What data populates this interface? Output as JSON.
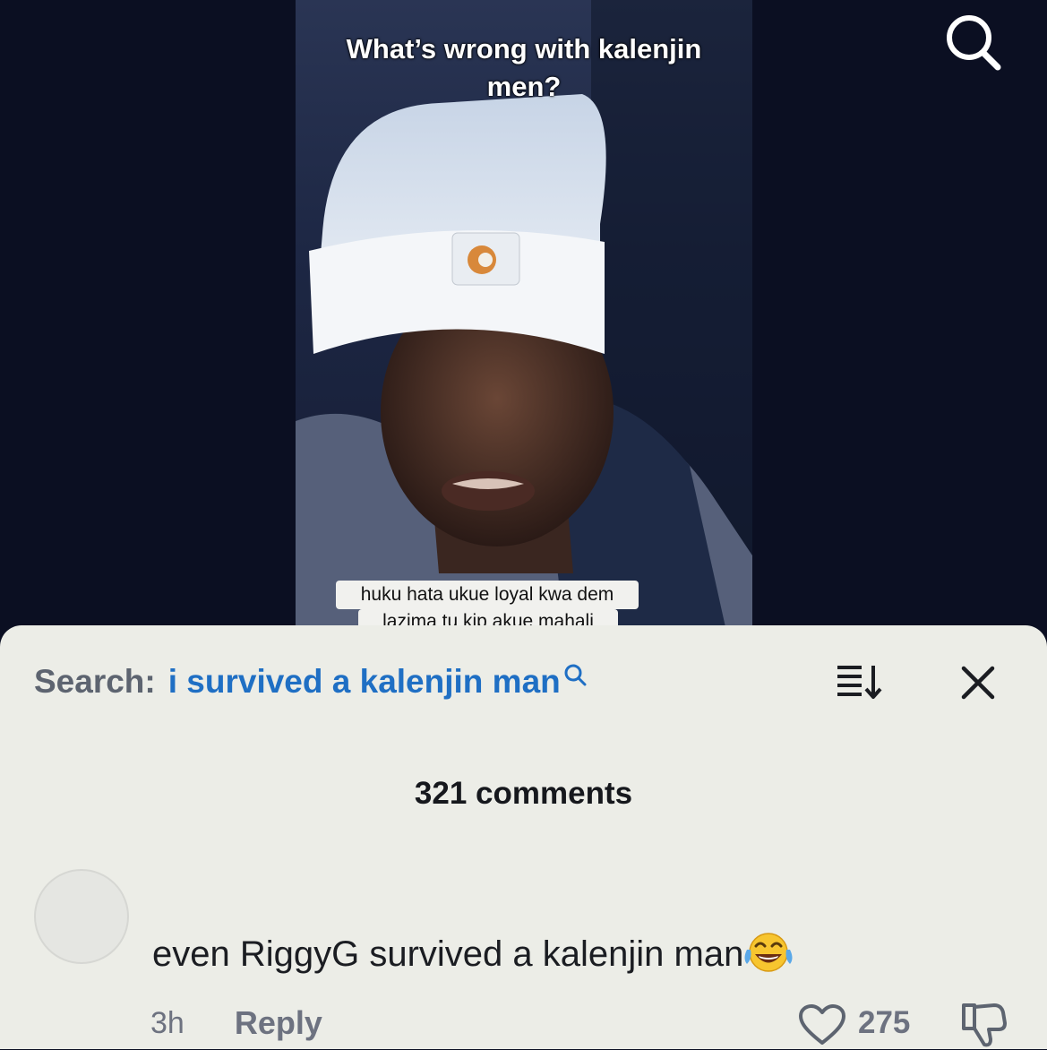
{
  "video": {
    "title": "What’s wrong with kalenjin men?",
    "caption_line1": "huku hata ukue loyal kwa dem",
    "caption_line2": "lazima tu kip akue mahali"
  },
  "top_bar": {
    "search_icon": "search-icon"
  },
  "comments_panel": {
    "search_label": "Search:",
    "search_query": "i survived a kalenjin man",
    "sort_icon": "sort-icon",
    "close_icon": "close-icon",
    "comment_count": "321 comments",
    "comments": [
      {
        "text": "even RiggyG survived a kalenjin man",
        "emoji": "tears-of-joy",
        "time": "3h",
        "reply_label": "Reply",
        "likes": "275"
      }
    ]
  },
  "colors": {
    "background": "#0b0f22",
    "sheet": "#ecede7",
    "link_blue": "#1f6fc4",
    "muted_text": "#6d7280"
  }
}
